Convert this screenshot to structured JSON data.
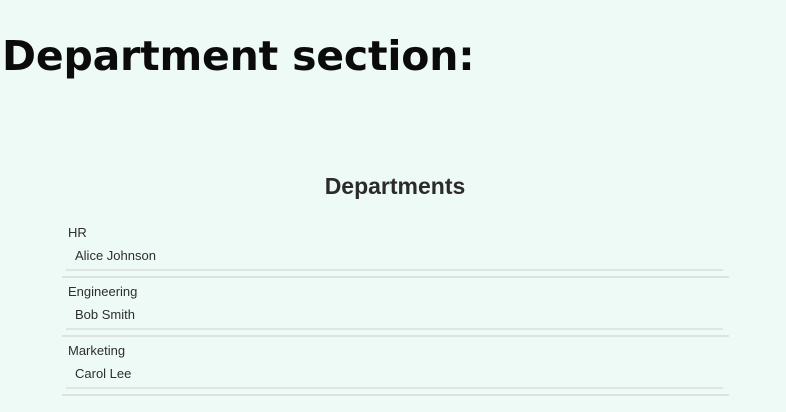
{
  "page": {
    "heading": "Department section:"
  },
  "panel": {
    "title": "Departments"
  },
  "departments": [
    {
      "name": "HR",
      "person": "Alice Johnson"
    },
    {
      "name": "Engineering",
      "person": "Bob Smith"
    },
    {
      "name": "Marketing",
      "person": "Carol Lee"
    }
  ]
}
